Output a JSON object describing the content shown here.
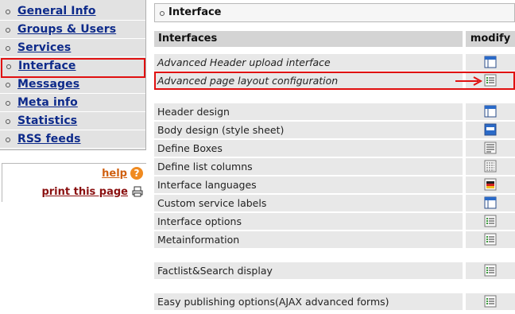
{
  "sidebar": {
    "nav": [
      {
        "label": "General Info",
        "active": false
      },
      {
        "label": "Groups & Users",
        "active": false
      },
      {
        "label": "Services",
        "active": false
      },
      {
        "label": "Interface",
        "active": true
      },
      {
        "label": "Messages",
        "active": false
      },
      {
        "label": "Meta info",
        "active": false
      },
      {
        "label": "Statistics",
        "active": false
      },
      {
        "label": "RSS feeds",
        "active": false
      }
    ],
    "help_label": "help",
    "print_label": "print this page"
  },
  "main": {
    "title": "Interface",
    "header_interfaces": "Interfaces",
    "header_modify": "modify",
    "rows": [
      {
        "name": "Advanced Header upload interface",
        "icon": "layout-header-icon"
      },
      {
        "name": "Advanced page layout configuration",
        "icon": "list-settings-icon"
      },
      {
        "name": "Header design",
        "icon": "layout-header-icon"
      },
      {
        "name": "Body design (style sheet)",
        "icon": "layout-body-icon"
      },
      {
        "name": "Define Boxes",
        "icon": "boxes-list-icon"
      },
      {
        "name": "Define list columns",
        "icon": "columns-grid-icon"
      },
      {
        "name": "Interface languages",
        "icon": "language-flag-icon"
      },
      {
        "name": "Custom service labels",
        "icon": "layout-header-icon"
      },
      {
        "name": "Interface options",
        "icon": "list-settings-icon"
      },
      {
        "name": "Metainformation",
        "icon": "list-settings-icon"
      },
      {
        "name": "Factlist&Search display",
        "icon": "list-settings-icon"
      },
      {
        "name": "Easy publishing options(AJAX advanced forms)",
        "icon": "list-settings-icon"
      }
    ]
  },
  "colors": {
    "nav_link": "#0d2a8a",
    "highlight": "#e01010",
    "help": "#d06010",
    "print": "#8a1010",
    "row_bg": "#e8e8e8",
    "header_bg": "#d4d4d4"
  }
}
